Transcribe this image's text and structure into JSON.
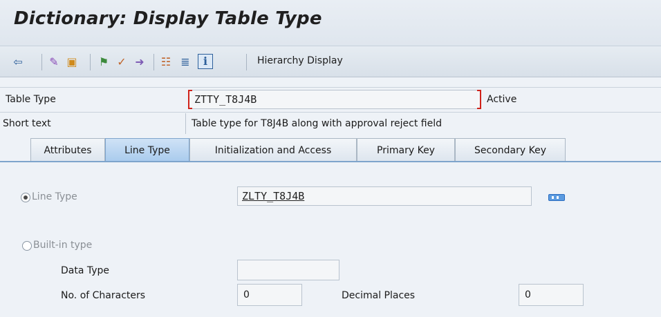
{
  "window": {
    "title": "Dictionary: Display Table Type"
  },
  "toolbar": {
    "icons": [
      "back-icon",
      "display-change-icon",
      "other-object-icon",
      "where-used-icon",
      "check-icon",
      "activate-icon",
      "hierarchy-icon",
      "list-icon",
      "info-icon"
    ],
    "hierarchy_label": "Hierarchy Display"
  },
  "header": {
    "table_type_label": "Table Type",
    "table_type_value": "ZTTY_T8J4B",
    "status": "Active",
    "short_text_label": "Short text",
    "short_text_value": "Table type for T8J4B along with approval reject field"
  },
  "tabs": [
    {
      "label": "Attributes",
      "active": false
    },
    {
      "label": "Line Type",
      "active": true
    },
    {
      "label": "Initialization and Access",
      "active": false
    },
    {
      "label": "Primary Key",
      "active": false
    },
    {
      "label": "Secondary Key",
      "active": false
    }
  ],
  "line_type": {
    "radio_line_type_label": "Line Type",
    "line_type_value": "ZLTY_T8J4B",
    "radio_builtin_label": "Built-in type",
    "data_type_label": "Data Type",
    "data_type_value": "",
    "no_chars_label": "No. of Characters",
    "no_chars_value": "0",
    "decimal_label": "Decimal Places",
    "decimal_value": "0"
  },
  "colors": {
    "accent": "#2d5f9a",
    "tab_active": "#a9cbed",
    "required": "#d0231a"
  }
}
